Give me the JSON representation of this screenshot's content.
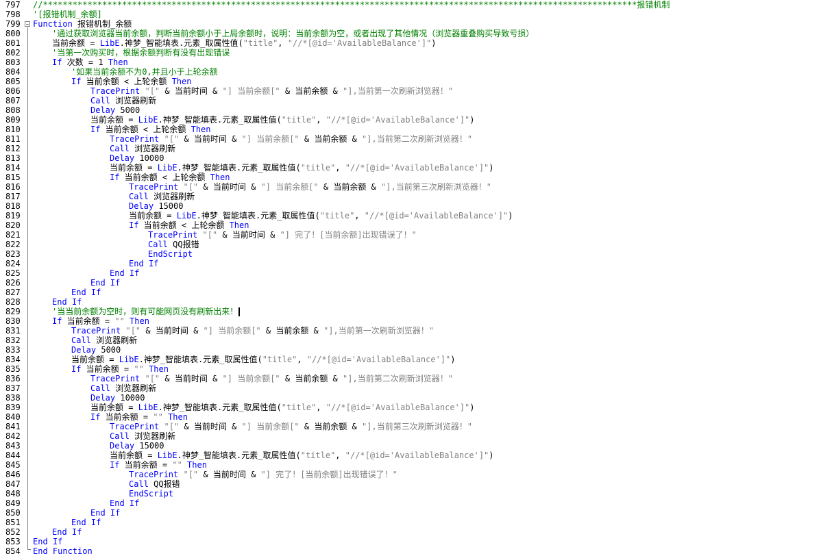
{
  "lines": [
    {
      "n": "797",
      "tokens": [
        {
          "t": "c",
          "v": "//************************************************************************************************************************报错机制"
        }
      ]
    },
    {
      "n": "798",
      "tokens": [
        {
          "t": "c",
          "v": "'[报错机制_余额]"
        }
      ]
    },
    {
      "n": "799",
      "tokens": [
        {
          "t": "k",
          "v": "Function"
        },
        {
          "t": "x",
          "v": " 报错机制_余额"
        }
      ]
    },
    {
      "n": "800",
      "indent": 1,
      "tokens": [
        {
          "t": "c",
          "v": "'通过获取浏览器当前余额，判断当前余额小于上局余额时，说明：当前余额为空，或者出现了其他情况（浏览器重叠购买导致亏损）"
        }
      ]
    },
    {
      "n": "801",
      "indent": 1,
      "tokens": [
        {
          "t": "x",
          "v": "当前余额 = "
        },
        {
          "t": "k",
          "v": "LibE"
        },
        {
          "t": "x",
          "v": ".神梦_智能填表.元素_取属性值("
        },
        {
          "t": "s",
          "v": "\"title\""
        },
        {
          "t": "x",
          "v": ", "
        },
        {
          "t": "s",
          "v": "\"//*[@id='AvailableBalance']\""
        },
        {
          "t": "x",
          "v": ")"
        }
      ]
    },
    {
      "n": "802",
      "indent": 1,
      "tokens": [
        {
          "t": "c",
          "v": "'当第一次购买时，根据余额判断有没有出现错误"
        }
      ]
    },
    {
      "n": "803",
      "indent": 1,
      "tokens": [
        {
          "t": "k",
          "v": "If"
        },
        {
          "t": "x",
          "v": " 次数 = 1 "
        },
        {
          "t": "k",
          "v": "Then"
        }
      ]
    },
    {
      "n": "804",
      "indent": 2,
      "tokens": [
        {
          "t": "c",
          "v": "'如果当前余额不为0,并且小于上轮余额"
        }
      ]
    },
    {
      "n": "805",
      "indent": 2,
      "tokens": [
        {
          "t": "k",
          "v": "If"
        },
        {
          "t": "x",
          "v": " 当前余额 < 上轮余额 "
        },
        {
          "t": "k",
          "v": "Then"
        }
      ]
    },
    {
      "n": "806",
      "indent": 3,
      "tokens": [
        {
          "t": "k",
          "v": "TracePrint"
        },
        {
          "t": "x",
          "v": " "
        },
        {
          "t": "s",
          "v": "\"[\""
        },
        {
          "t": "x",
          "v": " & 当前时间 & "
        },
        {
          "t": "s",
          "v": "\"] 当前余额[\""
        },
        {
          "t": "x",
          "v": " & 当前余额 & "
        },
        {
          "t": "s",
          "v": "\"],当前第一次刷新浏览器！\""
        }
      ]
    },
    {
      "n": "807",
      "indent": 3,
      "tokens": [
        {
          "t": "k",
          "v": "Call"
        },
        {
          "t": "x",
          "v": " 浏览器刷新"
        }
      ]
    },
    {
      "n": "808",
      "indent": 3,
      "tokens": [
        {
          "t": "k",
          "v": "Delay"
        },
        {
          "t": "x",
          "v": " 5000"
        }
      ]
    },
    {
      "n": "809",
      "indent": 3,
      "tokens": [
        {
          "t": "x",
          "v": "当前余额 = "
        },
        {
          "t": "k",
          "v": "LibE"
        },
        {
          "t": "x",
          "v": ".神梦_智能填表.元素_取属性值("
        },
        {
          "t": "s",
          "v": "\"title\""
        },
        {
          "t": "x",
          "v": ", "
        },
        {
          "t": "s",
          "v": "\"//*[@id='AvailableBalance']\""
        },
        {
          "t": "x",
          "v": ")"
        }
      ]
    },
    {
      "n": "810",
      "indent": 3,
      "tokens": [
        {
          "t": "k",
          "v": "If"
        },
        {
          "t": "x",
          "v": " 当前余额 < 上轮余额 "
        },
        {
          "t": "k",
          "v": "Then"
        }
      ]
    },
    {
      "n": "811",
      "indent": 4,
      "tokens": [
        {
          "t": "k",
          "v": "TracePrint"
        },
        {
          "t": "x",
          "v": " "
        },
        {
          "t": "s",
          "v": "\"[\""
        },
        {
          "t": "x",
          "v": " & 当前时间 & "
        },
        {
          "t": "s",
          "v": "\"] 当前余额[\""
        },
        {
          "t": "x",
          "v": " & 当前余额 & "
        },
        {
          "t": "s",
          "v": "\"],当前第二次刷新浏览器！\""
        }
      ]
    },
    {
      "n": "812",
      "indent": 4,
      "tokens": [
        {
          "t": "k",
          "v": "Call"
        },
        {
          "t": "x",
          "v": " 浏览器刷新"
        }
      ]
    },
    {
      "n": "813",
      "indent": 4,
      "tokens": [
        {
          "t": "k",
          "v": "Delay"
        },
        {
          "t": "x",
          "v": " 10000"
        }
      ]
    },
    {
      "n": "814",
      "indent": 4,
      "tokens": [
        {
          "t": "x",
          "v": "当前余额 = "
        },
        {
          "t": "k",
          "v": "LibE"
        },
        {
          "t": "x",
          "v": ".神梦_智能填表.元素_取属性值("
        },
        {
          "t": "s",
          "v": "\"title\""
        },
        {
          "t": "x",
          "v": ", "
        },
        {
          "t": "s",
          "v": "\"//*[@id='AvailableBalance']\""
        },
        {
          "t": "x",
          "v": ")"
        }
      ]
    },
    {
      "n": "815",
      "indent": 4,
      "tokens": [
        {
          "t": "k",
          "v": "If"
        },
        {
          "t": "x",
          "v": " 当前余额 < 上轮余额 "
        },
        {
          "t": "k",
          "v": "Then"
        }
      ]
    },
    {
      "n": "816",
      "indent": 5,
      "tokens": [
        {
          "t": "k",
          "v": "TracePrint"
        },
        {
          "t": "x",
          "v": " "
        },
        {
          "t": "s",
          "v": "\"[\""
        },
        {
          "t": "x",
          "v": " & 当前时间 & "
        },
        {
          "t": "s",
          "v": "\"] 当前余额[\""
        },
        {
          "t": "x",
          "v": " & 当前余额 & "
        },
        {
          "t": "s",
          "v": "\"],当前第三次刷新浏览器！\""
        }
      ]
    },
    {
      "n": "817",
      "indent": 5,
      "tokens": [
        {
          "t": "k",
          "v": "Call"
        },
        {
          "t": "x",
          "v": " 浏览器刷新"
        }
      ]
    },
    {
      "n": "818",
      "indent": 5,
      "tokens": [
        {
          "t": "k",
          "v": "Delay"
        },
        {
          "t": "x",
          "v": " 15000"
        }
      ]
    },
    {
      "n": "819",
      "indent": 5,
      "tokens": [
        {
          "t": "x",
          "v": "当前余额 = "
        },
        {
          "t": "k",
          "v": "LibE"
        },
        {
          "t": "x",
          "v": ".神梦_智能填表.元素_取属性值("
        },
        {
          "t": "s",
          "v": "\"title\""
        },
        {
          "t": "x",
          "v": ", "
        },
        {
          "t": "s",
          "v": "\"//*[@id='AvailableBalance']\""
        },
        {
          "t": "x",
          "v": ")"
        }
      ]
    },
    {
      "n": "820",
      "indent": 5,
      "tokens": [
        {
          "t": "k",
          "v": "If"
        },
        {
          "t": "x",
          "v": " 当前余额 < 上轮余额 "
        },
        {
          "t": "k",
          "v": "Then"
        }
      ]
    },
    {
      "n": "821",
      "indent": 6,
      "tokens": [
        {
          "t": "k",
          "v": "TracePrint"
        },
        {
          "t": "x",
          "v": " "
        },
        {
          "t": "s",
          "v": "\"[\""
        },
        {
          "t": "x",
          "v": " & 当前时间 & "
        },
        {
          "t": "s",
          "v": "\"] 完了！[当前余额]出现错误了！\""
        }
      ]
    },
    {
      "n": "822",
      "indent": 6,
      "tokens": [
        {
          "t": "k",
          "v": "Call"
        },
        {
          "t": "x",
          "v": " QQ报错"
        }
      ]
    },
    {
      "n": "823",
      "indent": 6,
      "tokens": [
        {
          "t": "k",
          "v": "EndScript"
        }
      ]
    },
    {
      "n": "824",
      "indent": 5,
      "tokens": [
        {
          "t": "k",
          "v": "End If"
        }
      ]
    },
    {
      "n": "825",
      "indent": 4,
      "tokens": [
        {
          "t": "k",
          "v": "End If"
        }
      ]
    },
    {
      "n": "826",
      "indent": 3,
      "tokens": [
        {
          "t": "k",
          "v": "End If"
        }
      ]
    },
    {
      "n": "827",
      "indent": 2,
      "tokens": [
        {
          "t": "k",
          "v": "End If"
        }
      ]
    },
    {
      "n": "828",
      "indent": 1,
      "tokens": [
        {
          "t": "k",
          "v": "End If"
        }
      ]
    },
    {
      "n": "829",
      "indent": 1,
      "caret": true,
      "tokens": [
        {
          "t": "c",
          "v": "'当当前余额为空时，则有可能网页没有刷新出来！"
        }
      ]
    },
    {
      "n": "830",
      "indent": 1,
      "tokens": [
        {
          "t": "k",
          "v": "If"
        },
        {
          "t": "x",
          "v": " 当前余额 = "
        },
        {
          "t": "s",
          "v": "\"\""
        },
        {
          "t": "x",
          "v": " "
        },
        {
          "t": "k",
          "v": "Then"
        }
      ]
    },
    {
      "n": "831",
      "indent": 2,
      "tokens": [
        {
          "t": "k",
          "v": "TracePrint"
        },
        {
          "t": "x",
          "v": " "
        },
        {
          "t": "s",
          "v": "\"[\""
        },
        {
          "t": "x",
          "v": " & 当前时间 & "
        },
        {
          "t": "s",
          "v": "\"] 当前余额[\""
        },
        {
          "t": "x",
          "v": " & 当前余额 & "
        },
        {
          "t": "s",
          "v": "\"],当前第一次刷新浏览器！\""
        }
      ]
    },
    {
      "n": "832",
      "indent": 2,
      "tokens": [
        {
          "t": "k",
          "v": "Call"
        },
        {
          "t": "x",
          "v": " 浏览器刷新"
        }
      ]
    },
    {
      "n": "833",
      "indent": 2,
      "tokens": [
        {
          "t": "k",
          "v": "Delay"
        },
        {
          "t": "x",
          "v": " 5000"
        }
      ]
    },
    {
      "n": "834",
      "indent": 2,
      "tokens": [
        {
          "t": "x",
          "v": "当前余额 = "
        },
        {
          "t": "k",
          "v": "LibE"
        },
        {
          "t": "x",
          "v": ".神梦_智能填表.元素_取属性值("
        },
        {
          "t": "s",
          "v": "\"title\""
        },
        {
          "t": "x",
          "v": ", "
        },
        {
          "t": "s",
          "v": "\"//*[@id='AvailableBalance']\""
        },
        {
          "t": "x",
          "v": ")"
        }
      ]
    },
    {
      "n": "835",
      "indent": 2,
      "tokens": [
        {
          "t": "k",
          "v": "If"
        },
        {
          "t": "x",
          "v": " 当前余额 = "
        },
        {
          "t": "s",
          "v": "\"\""
        },
        {
          "t": "x",
          "v": " "
        },
        {
          "t": "k",
          "v": "Then"
        }
      ]
    },
    {
      "n": "836",
      "indent": 3,
      "tokens": [
        {
          "t": "k",
          "v": "TracePrint"
        },
        {
          "t": "x",
          "v": " "
        },
        {
          "t": "s",
          "v": "\"[\""
        },
        {
          "t": "x",
          "v": " & 当前时间 & "
        },
        {
          "t": "s",
          "v": "\"] 当前余额[\""
        },
        {
          "t": "x",
          "v": " & 当前余额 & "
        },
        {
          "t": "s",
          "v": "\"],当前第二次刷新浏览器！\""
        }
      ]
    },
    {
      "n": "837",
      "indent": 3,
      "tokens": [
        {
          "t": "k",
          "v": "Call"
        },
        {
          "t": "x",
          "v": " 浏览器刷新"
        }
      ]
    },
    {
      "n": "838",
      "indent": 3,
      "tokens": [
        {
          "t": "k",
          "v": "Delay"
        },
        {
          "t": "x",
          "v": " 10000"
        }
      ]
    },
    {
      "n": "839",
      "indent": 3,
      "tokens": [
        {
          "t": "x",
          "v": "当前余额 = "
        },
        {
          "t": "k",
          "v": "LibE"
        },
        {
          "t": "x",
          "v": ".神梦_智能填表.元素_取属性值("
        },
        {
          "t": "s",
          "v": "\"title\""
        },
        {
          "t": "x",
          "v": ", "
        },
        {
          "t": "s",
          "v": "\"//*[@id='AvailableBalance']\""
        },
        {
          "t": "x",
          "v": ")"
        }
      ]
    },
    {
      "n": "840",
      "indent": 3,
      "tokens": [
        {
          "t": "k",
          "v": "If"
        },
        {
          "t": "x",
          "v": " 当前余额 = "
        },
        {
          "t": "s",
          "v": "\"\""
        },
        {
          "t": "x",
          "v": " "
        },
        {
          "t": "k",
          "v": "Then"
        }
      ]
    },
    {
      "n": "841",
      "indent": 4,
      "tokens": [
        {
          "t": "k",
          "v": "TracePrint"
        },
        {
          "t": "x",
          "v": " "
        },
        {
          "t": "s",
          "v": "\"[\""
        },
        {
          "t": "x",
          "v": " & 当前时间 & "
        },
        {
          "t": "s",
          "v": "\"] 当前余额[\""
        },
        {
          "t": "x",
          "v": " & 当前余额 & "
        },
        {
          "t": "s",
          "v": "\"],当前第三次刷新浏览器！\""
        }
      ]
    },
    {
      "n": "842",
      "indent": 4,
      "tokens": [
        {
          "t": "k",
          "v": "Call"
        },
        {
          "t": "x",
          "v": " 浏览器刷新"
        }
      ]
    },
    {
      "n": "843",
      "indent": 4,
      "tokens": [
        {
          "t": "k",
          "v": "Delay"
        },
        {
          "t": "x",
          "v": " 15000"
        }
      ]
    },
    {
      "n": "844",
      "indent": 4,
      "tokens": [
        {
          "t": "x",
          "v": "当前余额 = "
        },
        {
          "t": "k",
          "v": "LibE"
        },
        {
          "t": "x",
          "v": ".神梦_智能填表.元素_取属性值("
        },
        {
          "t": "s",
          "v": "\"title\""
        },
        {
          "t": "x",
          "v": ", "
        },
        {
          "t": "s",
          "v": "\"//*[@id='AvailableBalance']\""
        },
        {
          "t": "x",
          "v": ")"
        }
      ]
    },
    {
      "n": "845",
      "indent": 4,
      "tokens": [
        {
          "t": "k",
          "v": "If"
        },
        {
          "t": "x",
          "v": " 当前余额 = "
        },
        {
          "t": "s",
          "v": "\"\""
        },
        {
          "t": "x",
          "v": " "
        },
        {
          "t": "k",
          "v": "Then"
        }
      ]
    },
    {
      "n": "846",
      "indent": 5,
      "tokens": [
        {
          "t": "k",
          "v": "TracePrint"
        },
        {
          "t": "x",
          "v": " "
        },
        {
          "t": "s",
          "v": "\"[\""
        },
        {
          "t": "x",
          "v": " & 当前时间 & "
        },
        {
          "t": "s",
          "v": "\"] 完了！[当前余额]出现错误了！\""
        }
      ]
    },
    {
      "n": "847",
      "indent": 5,
      "tokens": [
        {
          "t": "k",
          "v": "Call"
        },
        {
          "t": "x",
          "v": " QQ报错"
        }
      ]
    },
    {
      "n": "848",
      "indent": 5,
      "tokens": [
        {
          "t": "k",
          "v": "EndScript"
        }
      ]
    },
    {
      "n": "849",
      "indent": 4,
      "tokens": [
        {
          "t": "k",
          "v": "End If"
        }
      ]
    },
    {
      "n": "850",
      "indent": 3,
      "tokens": [
        {
          "t": "k",
          "v": "End If"
        }
      ]
    },
    {
      "n": "851",
      "indent": 2,
      "tokens": [
        {
          "t": "k",
          "v": "End If"
        }
      ]
    },
    {
      "n": "852",
      "indent": 1,
      "tokens": [
        {
          "t": "k",
          "v": "End If"
        }
      ]
    },
    {
      "n": "853",
      "indent": 0,
      "tokens": [
        {
          "t": "k",
          "v": "End If"
        }
      ]
    },
    {
      "n": "854",
      "indent": 0,
      "tokens": [
        {
          "t": "k",
          "v": "End Function"
        }
      ]
    }
  ],
  "colors": {
    "keyword": "#0000ff",
    "string": "#808080",
    "comment": "#008000",
    "text": "#000000",
    "background": "#ffffff"
  }
}
